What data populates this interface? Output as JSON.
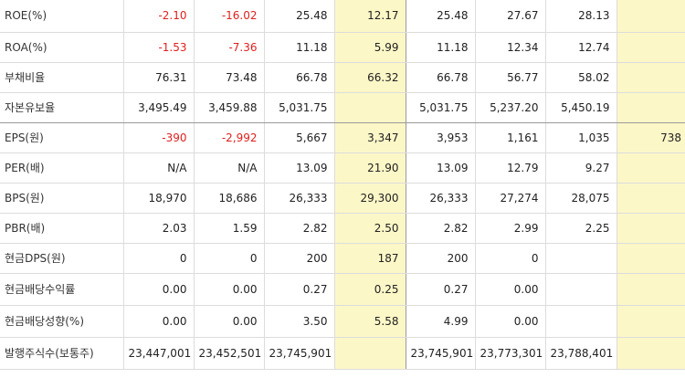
{
  "rows": [
    {
      "label": "ROE(%)",
      "values": [
        "-2.10",
        "-16.02",
        "25.48",
        "12.17",
        "25.48",
        "27.67",
        "28.13",
        ""
      ],
      "neg": [
        true,
        true,
        false,
        false,
        false,
        false,
        false,
        false
      ]
    },
    {
      "label": "ROA(%)",
      "values": [
        "-1.53",
        "-7.36",
        "11.18",
        "5.99",
        "11.18",
        "12.34",
        "12.74",
        ""
      ],
      "neg": [
        true,
        true,
        false,
        false,
        false,
        false,
        false,
        false
      ]
    },
    {
      "label": "부채비율",
      "values": [
        "76.31",
        "73.48",
        "66.78",
        "66.32",
        "66.78",
        "56.77",
        "58.02",
        ""
      ],
      "neg": [
        false,
        false,
        false,
        false,
        false,
        false,
        false,
        false
      ]
    },
    {
      "label": "자본유보율",
      "values": [
        "3,495.49",
        "3,459.88",
        "5,031.75",
        "",
        "5,031.75",
        "5,237.20",
        "5,450.19",
        ""
      ],
      "neg": [
        false,
        false,
        false,
        false,
        false,
        false,
        false,
        false
      ]
    },
    {
      "label": "EPS(원)",
      "values": [
        "-390",
        "-2,992",
        "5,667",
        "3,347",
        "3,953",
        "1,161",
        "1,035",
        "738"
      ],
      "neg": [
        true,
        true,
        false,
        false,
        false,
        false,
        false,
        false
      ]
    },
    {
      "label": "PER(배)",
      "values": [
        "N/A",
        "N/A",
        "13.09",
        "21.90",
        "13.09",
        "12.79",
        "9.27",
        ""
      ],
      "neg": [
        false,
        false,
        false,
        false,
        false,
        false,
        false,
        false
      ]
    },
    {
      "label": "BPS(원)",
      "values": [
        "18,970",
        "18,686",
        "26,333",
        "29,300",
        "26,333",
        "27,274",
        "28,075",
        ""
      ],
      "neg": [
        false,
        false,
        false,
        false,
        false,
        false,
        false,
        false
      ]
    },
    {
      "label": "PBR(배)",
      "values": [
        "2.03",
        "1.59",
        "2.82",
        "2.50",
        "2.82",
        "2.99",
        "2.25",
        ""
      ],
      "neg": [
        false,
        false,
        false,
        false,
        false,
        false,
        false,
        false
      ]
    },
    {
      "label": "현금DPS(원)",
      "values": [
        "0",
        "0",
        "200",
        "187",
        "200",
        "0",
        "",
        ""
      ],
      "neg": [
        false,
        false,
        false,
        false,
        false,
        false,
        false,
        false
      ]
    },
    {
      "label": "현금배당수익률",
      "values": [
        "0.00",
        "0.00",
        "0.27",
        "0.25",
        "0.27",
        "0.00",
        "",
        ""
      ],
      "neg": [
        false,
        false,
        false,
        false,
        false,
        false,
        false,
        false
      ]
    },
    {
      "label": "현금배당성향(%)",
      "values": [
        "0.00",
        "0.00",
        "3.50",
        "5.58",
        "4.99",
        "0.00",
        "",
        ""
      ],
      "neg": [
        false,
        false,
        false,
        false,
        false,
        false,
        false,
        false
      ]
    },
    {
      "label": "발행주식수(보통주)",
      "values": [
        "23,447,001",
        "23,452,501",
        "23,745,901",
        "",
        "23,745,901",
        "23,773,301",
        "23,788,401",
        ""
      ],
      "neg": [
        false,
        false,
        false,
        false,
        false,
        false,
        false,
        false
      ]
    }
  ]
}
